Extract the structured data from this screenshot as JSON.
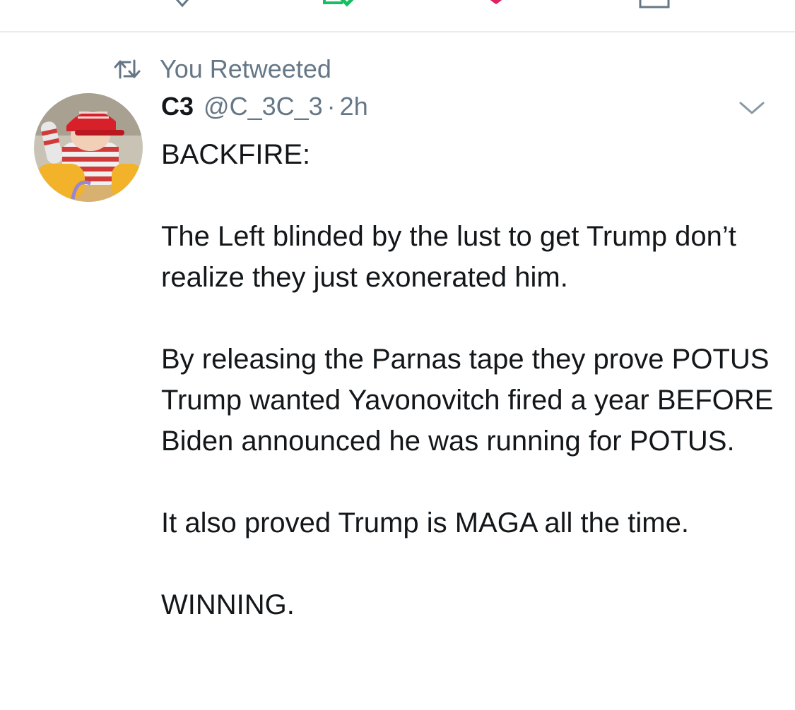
{
  "retweet_header": {
    "icon": "retweet-icon",
    "text": "You Retweeted"
  },
  "tweet": {
    "avatar_icon": "avatar-image",
    "display_name": "C3",
    "handle": "@C_3C_3",
    "separator": "·",
    "time": "2h",
    "menu_icon": "chevron-down-icon",
    "paragraphs": [
      "BACKFIRE:",
      "The Left blinded by the lust to get Trump don’t realize they just exonerated him.",
      "By releasing the Parnas tape they prove POTUS Trump wanted Yavonovitch fired a year BEFORE Biden announced he was running for POTUS.",
      "It also proved Trump is MAGA all the time.",
      "WINNING."
    ]
  },
  "colors": {
    "text": "#14171a",
    "secondary": "#657786",
    "retweet_green": "#17bf63",
    "like_red": "#e0245e",
    "divider": "#e6ecf0"
  }
}
